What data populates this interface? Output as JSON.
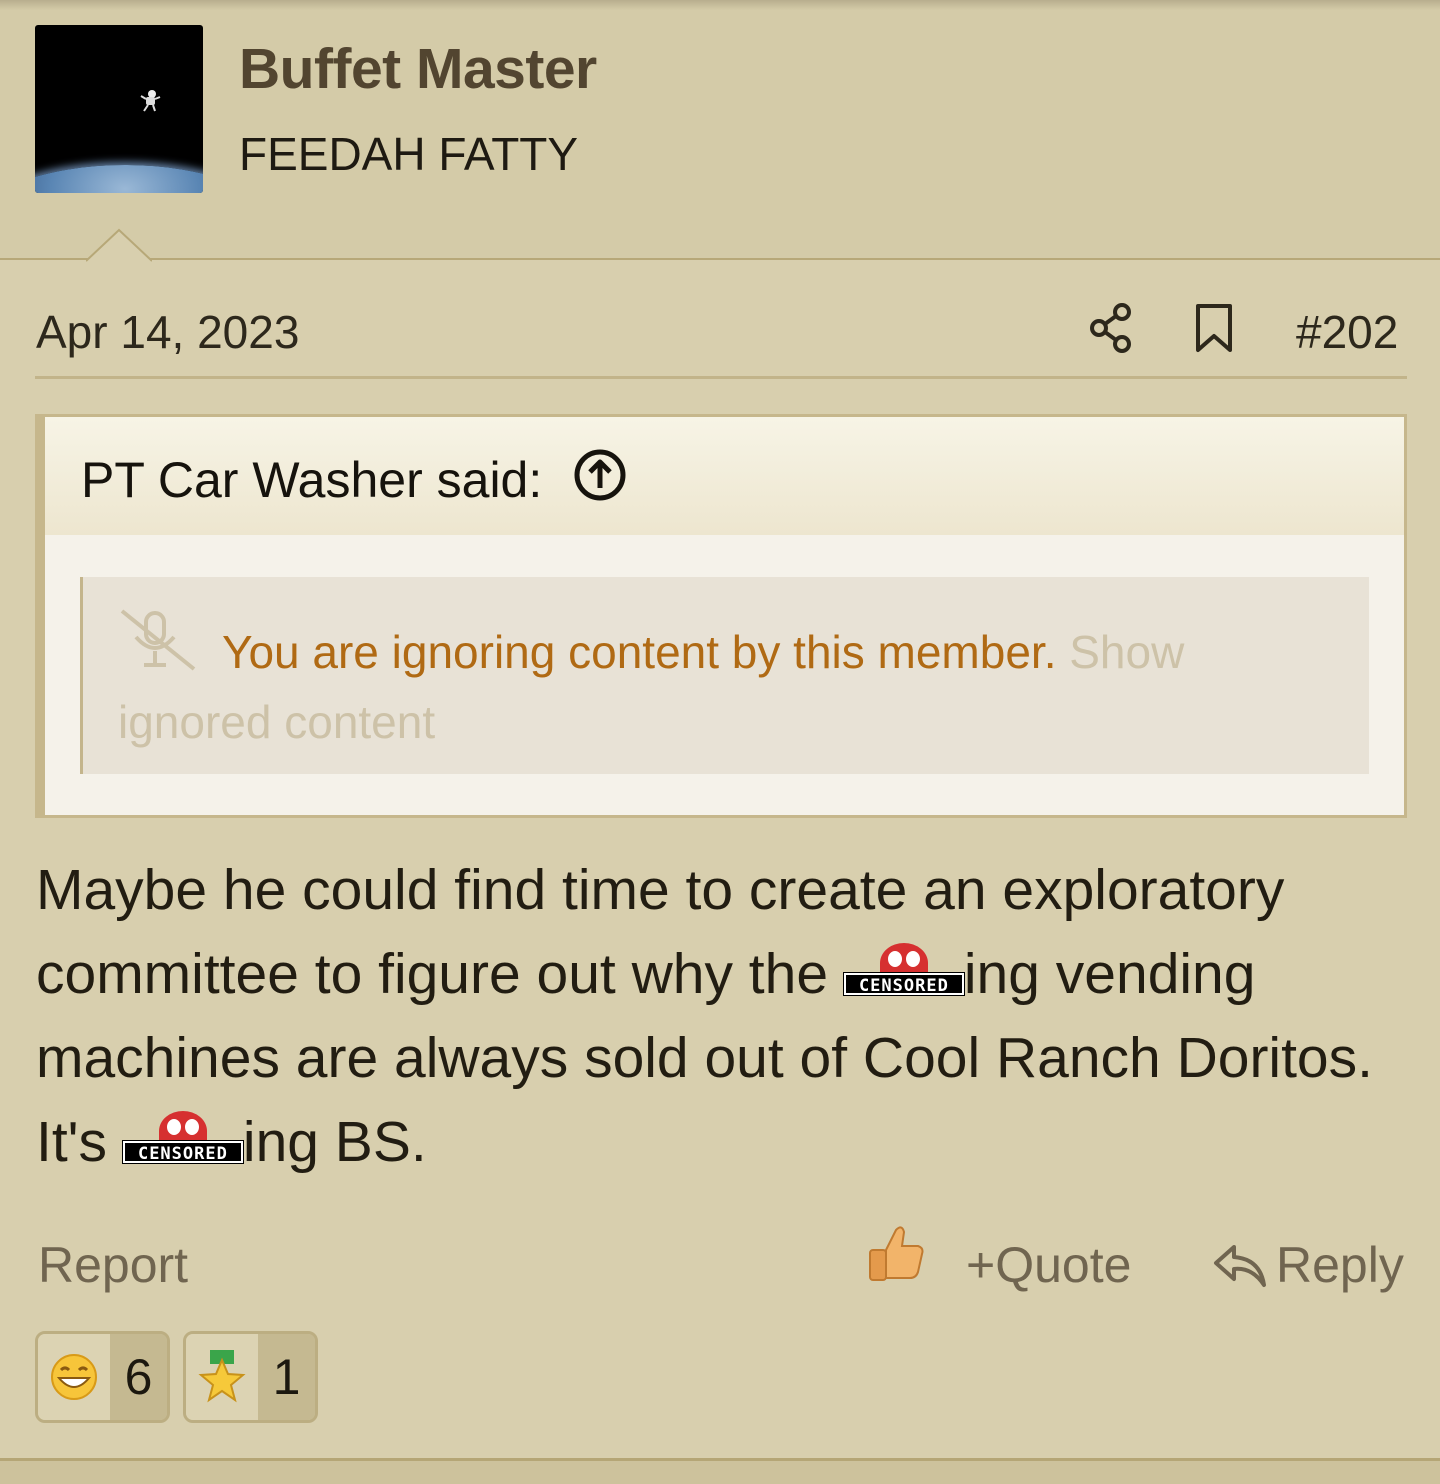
{
  "user": {
    "name": "Buffet Master",
    "title": "FEEDAH FATTY",
    "avatar_icon": "astronaut-earth-avatar"
  },
  "post": {
    "date": "Apr 14, 2023",
    "number": "#202",
    "share_icon": "share-icon",
    "bookmark_icon": "bookmark-icon"
  },
  "quote": {
    "author": "PT Car Washer said:",
    "goto_icon": "arrow-up-circle-icon",
    "ignored_message": "You are ignoring content by this member.",
    "show_ignored_label": "Show ignored content",
    "ignored_icon": "muted-microphone-icon"
  },
  "body": {
    "part1": "Maybe he could find time to create an exploratory committee to figure out why the ",
    "part2": "ing vending machines are always sold out of Cool Ranch Doritos. It's ",
    "part3": "ing BS.",
    "censor_label": "CENSORED"
  },
  "actions": {
    "report": "Report",
    "like_icon": "thumbs-up-icon",
    "quote": "Quote",
    "reply": "Reply"
  },
  "reactions": [
    {
      "icon": "grinning-face-icon",
      "count": "6"
    },
    {
      "icon": "star-medal-icon",
      "count": "1"
    }
  ],
  "colors": {
    "background": "#d8cfae",
    "ignored_text": "#b06a14",
    "muted_text": "#706550",
    "censor_red": "#d63030"
  }
}
